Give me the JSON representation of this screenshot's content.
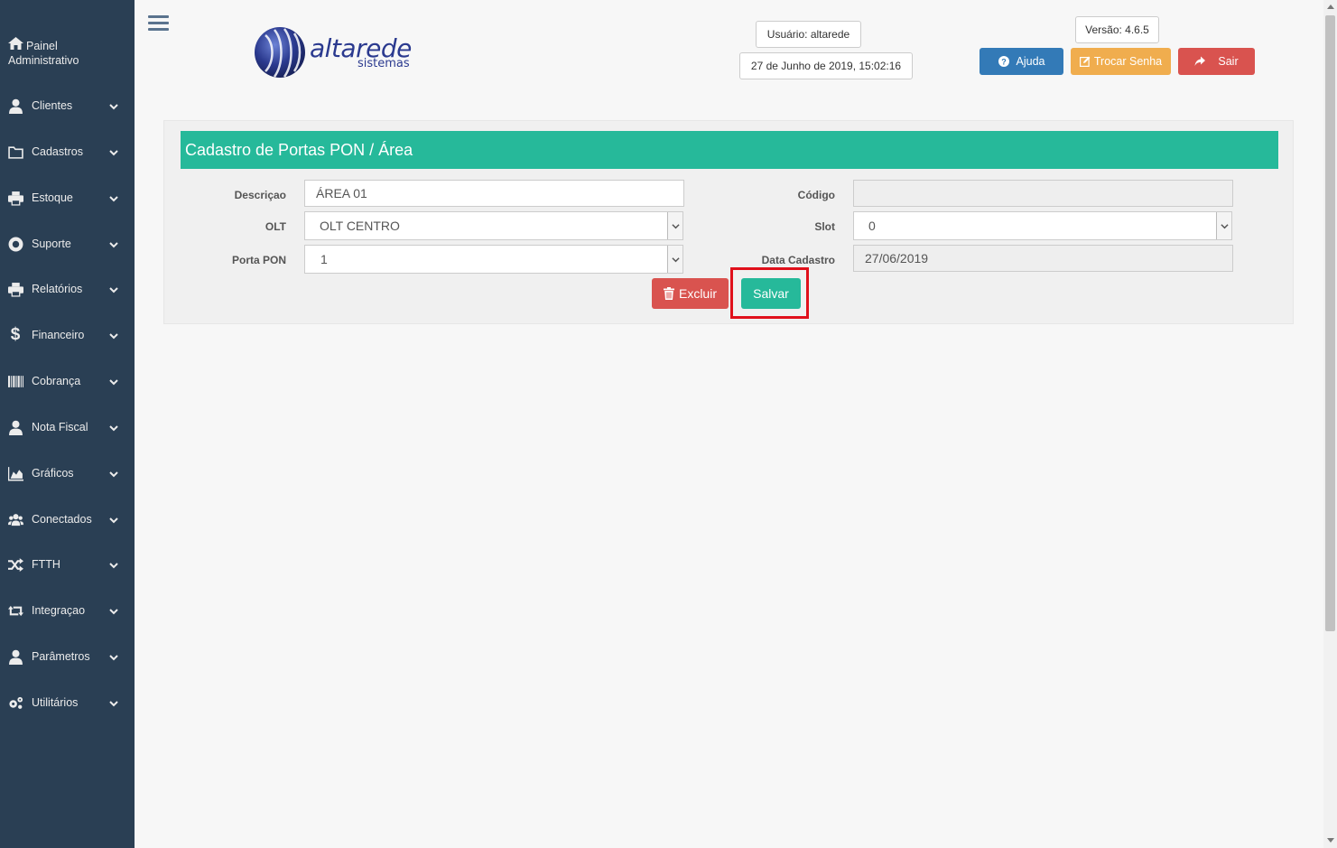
{
  "sidebar": {
    "home_line1": "Painel",
    "home_line2": "Administrativo",
    "items": [
      {
        "label": "Clientes",
        "icon": "user-icon"
      },
      {
        "label": "Cadastros",
        "icon": "folder-icon"
      },
      {
        "label": "Estoque",
        "icon": "print-icon"
      },
      {
        "label": "Suporte",
        "icon": "life-ring-icon"
      },
      {
        "label": "Relatórios",
        "icon": "print-icon"
      },
      {
        "label": "Financeiro",
        "icon": "dollar-icon"
      },
      {
        "label": "Cobrança",
        "icon": "barcode-icon"
      },
      {
        "label": "Nota Fiscal",
        "icon": "user-icon"
      },
      {
        "label": "Gráficos",
        "icon": "area-chart-icon"
      },
      {
        "label": "Conectados",
        "icon": "users-icon"
      },
      {
        "label": "FTTH",
        "icon": "random-icon"
      },
      {
        "label": "Integraçao",
        "icon": "retweet-icon"
      },
      {
        "label": "Parâmetros",
        "icon": "user-icon"
      },
      {
        "label": "Utilitários",
        "icon": "cogs-icon"
      }
    ]
  },
  "header": {
    "logo_text": "altarede",
    "logo_sub": "sistemas",
    "user": "Usuário: altarede",
    "datetime": "27 de Junho de 2019, 15:02:16",
    "version": "Versão: 4.6.5",
    "help_label": "Ajuda",
    "change_password_label": "Trocar Senha",
    "exit_label": "Sair"
  },
  "form": {
    "title": "Cadastro de Portas PON / Área",
    "descricao_label": "Descriçao",
    "descricao_value": "ÁREA 01",
    "olt_label": "OLT",
    "olt_value": "OLT CENTRO",
    "porta_label": "Porta PON",
    "porta_value": "1",
    "codigo_label": "Código",
    "codigo_value": "",
    "slot_label": "Slot",
    "slot_value": "0",
    "data_label": "Data Cadastro",
    "data_value": "27/06/2019",
    "delete_label": "Excluir",
    "save_label": "Salvar"
  },
  "colors": {
    "sidebar": "#2a3f54",
    "accent": "#26b99a",
    "danger": "#d9534f",
    "warning": "#f0ad4e",
    "primary": "#337ab7",
    "highlight": "#e0101b"
  }
}
